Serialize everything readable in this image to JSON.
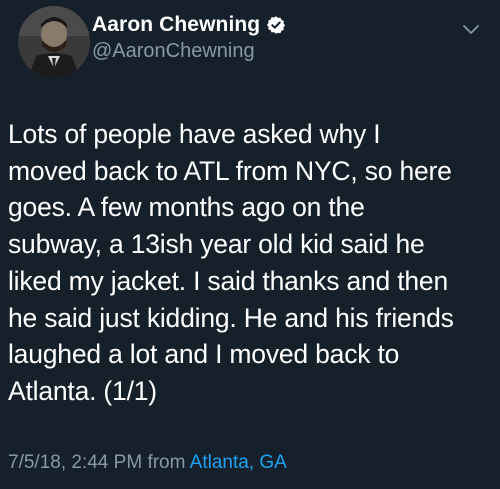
{
  "author": {
    "display_name": "Aaron Chewning",
    "handle": "@AaronChewning",
    "verified": true
  },
  "tweet": {
    "lines": [
      "Lots of people have asked why I",
      "moved back to ATL from NYC, so here",
      "goes. A few months ago on the",
      "subway, a 13ish year old kid said he",
      "liked my jacket. I said thanks and then",
      "he said just kidding. He and his friends",
      "laughed a lot and I moved back to",
      "Atlanta. (1/1)"
    ],
    "timestamp": "7/5/18, 2:44 PM",
    "from_label": "from",
    "location": "Atlanta, GA"
  },
  "icons": {
    "verified": "verified-badge-icon",
    "menu": "chevron-down-icon"
  },
  "colors": {
    "background": "#15202b",
    "secondary_text": "#8899a6",
    "link": "#1da1f2",
    "verified_badge": "#ffffff"
  }
}
